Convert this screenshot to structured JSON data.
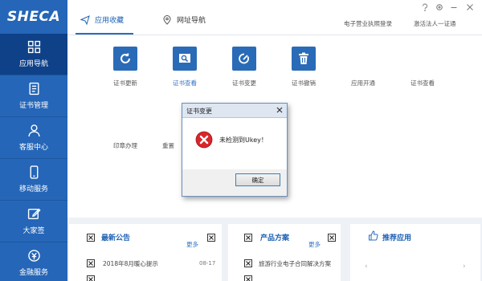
{
  "brand": {
    "logo_text": "SHECA"
  },
  "sidebar": {
    "items": [
      {
        "label": "应用导航",
        "icon": "grid-icon"
      },
      {
        "label": "证书管理",
        "icon": "document-icon"
      },
      {
        "label": "客服中心",
        "icon": "person-icon"
      },
      {
        "label": "移动服务",
        "icon": "mobile-icon"
      },
      {
        "label": "大家签",
        "icon": "edit-icon"
      },
      {
        "label": "金融服务",
        "icon": "finance-icon"
      }
    ]
  },
  "topbar": {
    "tabs": [
      {
        "label": "应用收藏",
        "icon": "paper-plane-icon"
      },
      {
        "label": "网址导航",
        "icon": "location-pin-icon"
      }
    ],
    "links": [
      "电子营业执照登录",
      "激活法人一证通"
    ]
  },
  "apps": {
    "row1": [
      "证书更新",
      "证书查看",
      "证书变更",
      "证书撤销",
      "应用开通",
      "证书查看"
    ],
    "row2": [
      "印章办理",
      "重置"
    ]
  },
  "panels": {
    "announcements": {
      "title": "最新公告",
      "more": "更多",
      "rows": [
        {
          "text": "2018年8月暖心提示",
          "date": "08-17"
        }
      ]
    },
    "solutions": {
      "title": "产品方案",
      "more": "更多",
      "rows": [
        {
          "text": "旅游行业电子合同解决方案"
        }
      ]
    },
    "recommend": {
      "title": "推荐应用"
    }
  },
  "dialog": {
    "title": "证书变更",
    "message": "未检测到Ukey！",
    "ok_label": "确定"
  },
  "colors": {
    "sidebar": "#2566b8",
    "accent": "#1e62b4",
    "error": "#d8262a"
  }
}
